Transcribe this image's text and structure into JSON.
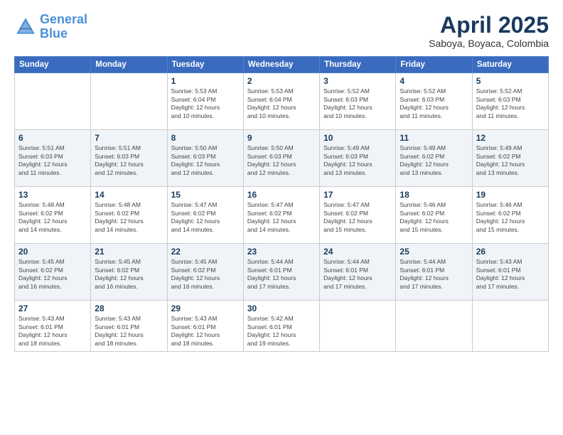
{
  "header": {
    "logo_line1": "General",
    "logo_line2": "Blue",
    "month": "April 2025",
    "location": "Saboya, Boyaca, Colombia"
  },
  "weekdays": [
    "Sunday",
    "Monday",
    "Tuesday",
    "Wednesday",
    "Thursday",
    "Friday",
    "Saturday"
  ],
  "rows": [
    [
      {
        "day": "",
        "info": ""
      },
      {
        "day": "",
        "info": ""
      },
      {
        "day": "1",
        "info": "Sunrise: 5:53 AM\nSunset: 6:04 PM\nDaylight: 12 hours\nand 10 minutes."
      },
      {
        "day": "2",
        "info": "Sunrise: 5:53 AM\nSunset: 6:04 PM\nDaylight: 12 hours\nand 10 minutes."
      },
      {
        "day": "3",
        "info": "Sunrise: 5:52 AM\nSunset: 6:03 PM\nDaylight: 12 hours\nand 10 minutes."
      },
      {
        "day": "4",
        "info": "Sunrise: 5:52 AM\nSunset: 6:03 PM\nDaylight: 12 hours\nand 11 minutes."
      },
      {
        "day": "5",
        "info": "Sunrise: 5:52 AM\nSunset: 6:03 PM\nDaylight: 12 hours\nand 11 minutes."
      }
    ],
    [
      {
        "day": "6",
        "info": "Sunrise: 5:51 AM\nSunset: 6:03 PM\nDaylight: 12 hours\nand 11 minutes."
      },
      {
        "day": "7",
        "info": "Sunrise: 5:51 AM\nSunset: 6:03 PM\nDaylight: 12 hours\nand 12 minutes."
      },
      {
        "day": "8",
        "info": "Sunrise: 5:50 AM\nSunset: 6:03 PM\nDaylight: 12 hours\nand 12 minutes."
      },
      {
        "day": "9",
        "info": "Sunrise: 5:50 AM\nSunset: 6:03 PM\nDaylight: 12 hours\nand 12 minutes."
      },
      {
        "day": "10",
        "info": "Sunrise: 5:49 AM\nSunset: 6:03 PM\nDaylight: 12 hours\nand 13 minutes."
      },
      {
        "day": "11",
        "info": "Sunrise: 5:49 AM\nSunset: 6:02 PM\nDaylight: 12 hours\nand 13 minutes."
      },
      {
        "day": "12",
        "info": "Sunrise: 5:49 AM\nSunset: 6:02 PM\nDaylight: 12 hours\nand 13 minutes."
      }
    ],
    [
      {
        "day": "13",
        "info": "Sunrise: 5:48 AM\nSunset: 6:02 PM\nDaylight: 12 hours\nand 14 minutes."
      },
      {
        "day": "14",
        "info": "Sunrise: 5:48 AM\nSunset: 6:02 PM\nDaylight: 12 hours\nand 14 minutes."
      },
      {
        "day": "15",
        "info": "Sunrise: 5:47 AM\nSunset: 6:02 PM\nDaylight: 12 hours\nand 14 minutes."
      },
      {
        "day": "16",
        "info": "Sunrise: 5:47 AM\nSunset: 6:02 PM\nDaylight: 12 hours\nand 14 minutes."
      },
      {
        "day": "17",
        "info": "Sunrise: 5:47 AM\nSunset: 6:02 PM\nDaylight: 12 hours\nand 15 minutes."
      },
      {
        "day": "18",
        "info": "Sunrise: 5:46 AM\nSunset: 6:02 PM\nDaylight: 12 hours\nand 15 minutes."
      },
      {
        "day": "19",
        "info": "Sunrise: 5:46 AM\nSunset: 6:02 PM\nDaylight: 12 hours\nand 15 minutes."
      }
    ],
    [
      {
        "day": "20",
        "info": "Sunrise: 5:45 AM\nSunset: 6:02 PM\nDaylight: 12 hours\nand 16 minutes."
      },
      {
        "day": "21",
        "info": "Sunrise: 5:45 AM\nSunset: 6:02 PM\nDaylight: 12 hours\nand 16 minutes."
      },
      {
        "day": "22",
        "info": "Sunrise: 5:45 AM\nSunset: 6:02 PM\nDaylight: 12 hours\nand 16 minutes."
      },
      {
        "day": "23",
        "info": "Sunrise: 5:44 AM\nSunset: 6:01 PM\nDaylight: 12 hours\nand 17 minutes."
      },
      {
        "day": "24",
        "info": "Sunrise: 5:44 AM\nSunset: 6:01 PM\nDaylight: 12 hours\nand 17 minutes."
      },
      {
        "day": "25",
        "info": "Sunrise: 5:44 AM\nSunset: 6:01 PM\nDaylight: 12 hours\nand 17 minutes."
      },
      {
        "day": "26",
        "info": "Sunrise: 5:43 AM\nSunset: 6:01 PM\nDaylight: 12 hours\nand 17 minutes."
      }
    ],
    [
      {
        "day": "27",
        "info": "Sunrise: 5:43 AM\nSunset: 6:01 PM\nDaylight: 12 hours\nand 18 minutes."
      },
      {
        "day": "28",
        "info": "Sunrise: 5:43 AM\nSunset: 6:01 PM\nDaylight: 12 hours\nand 18 minutes."
      },
      {
        "day": "29",
        "info": "Sunrise: 5:43 AM\nSunset: 6:01 PM\nDaylight: 12 hours\nand 18 minutes."
      },
      {
        "day": "30",
        "info": "Sunrise: 5:42 AM\nSunset: 6:01 PM\nDaylight: 12 hours\nand 19 minutes."
      },
      {
        "day": "",
        "info": ""
      },
      {
        "day": "",
        "info": ""
      },
      {
        "day": "",
        "info": ""
      }
    ]
  ]
}
